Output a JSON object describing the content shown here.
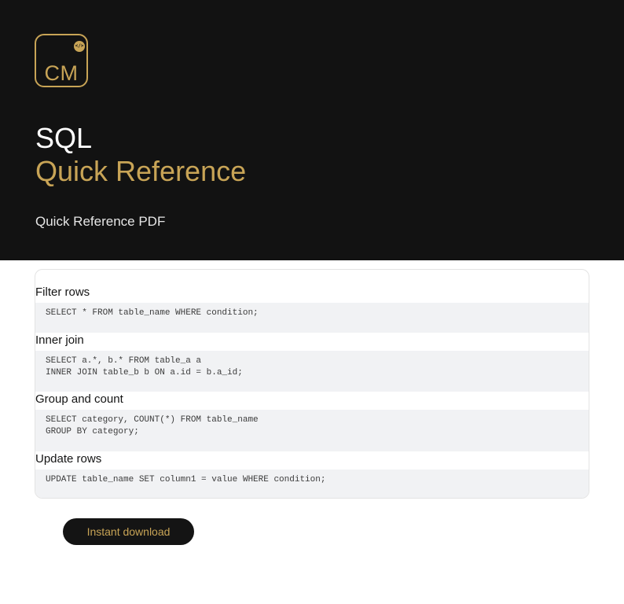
{
  "brand": {
    "logo_text": "CM",
    "logo_badge": "</>",
    "accent_color": "#c8a456",
    "hero_background": "#121212"
  },
  "hero": {
    "title_line1": "SQL",
    "title_line2": "Quick Reference",
    "subtitle": "Quick Reference PDF"
  },
  "sections": [
    {
      "heading": "Filter rows",
      "code": [
        "SELECT * FROM table_name WHERE condition;"
      ]
    },
    {
      "heading": "Inner join",
      "code": [
        "SELECT a.*, b.* FROM table_a a",
        "INNER JOIN table_b b ON a.id = b.a_id;"
      ]
    },
    {
      "heading": "Group and count",
      "code": [
        "SELECT category, COUNT(*) FROM table_name",
        "GROUP BY category;"
      ]
    },
    {
      "heading": "Update rows",
      "code": [
        "UPDATE table_name SET column1 = value WHERE condition;"
      ]
    }
  ],
  "cta": {
    "download_label": "Instant download"
  }
}
